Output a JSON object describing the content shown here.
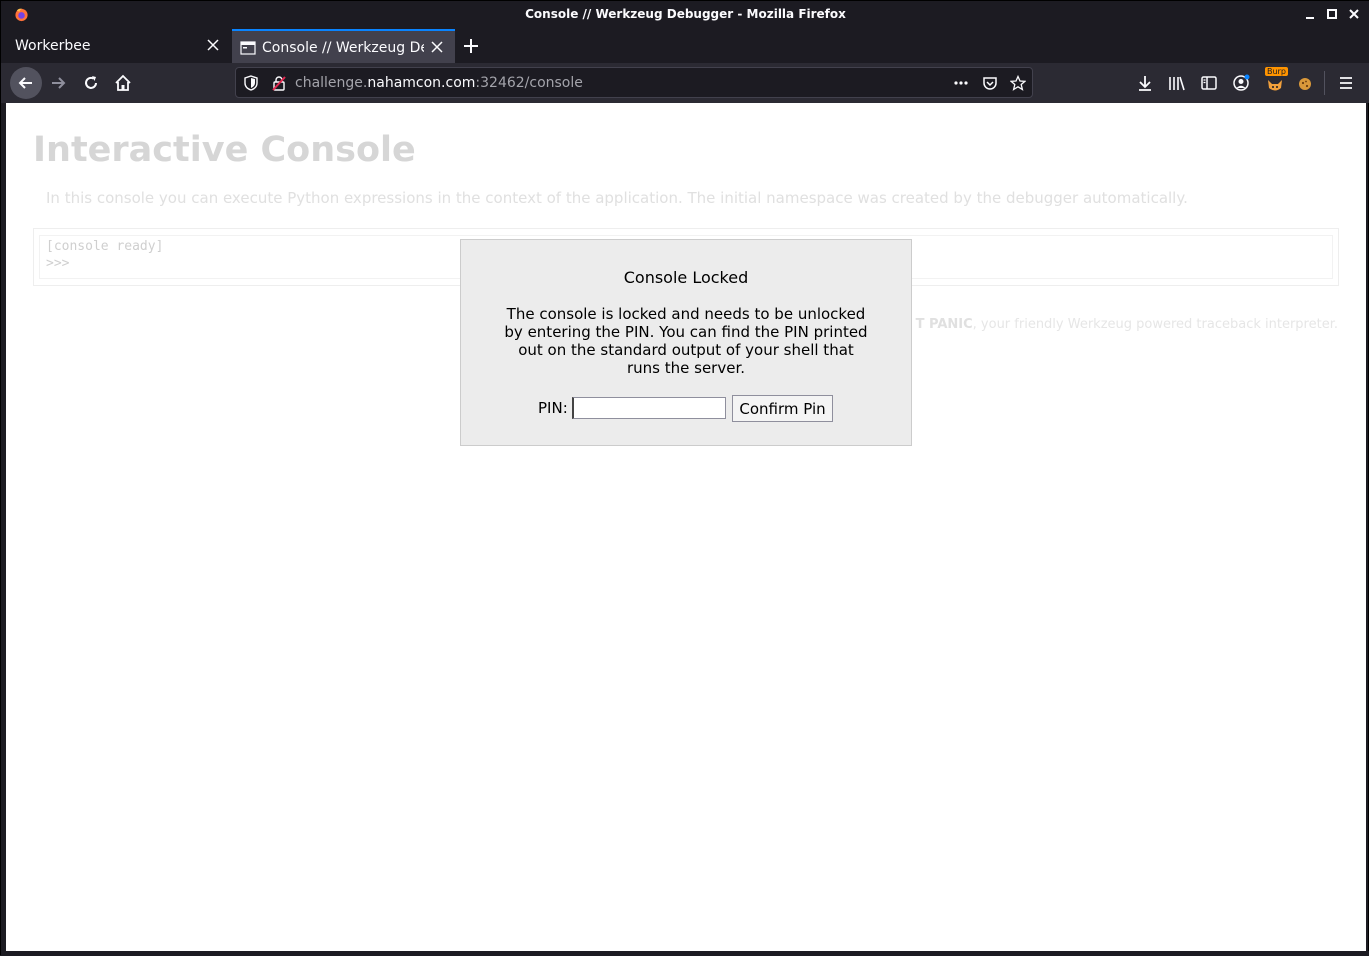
{
  "window": {
    "title": "Console // Werkzeug Debugger - Mozilla Firefox"
  },
  "tabs": [
    {
      "label": "Workerbee",
      "active": false
    },
    {
      "label": "Console // Werkzeug Deb",
      "active": true
    }
  ],
  "urlbar": {
    "prefix": "challenge.",
    "host": "nahamcon.com",
    "suffix": ":32462/console"
  },
  "toolbar": {
    "burp_badge": "Burp"
  },
  "page": {
    "title": "Interactive Console",
    "description": "In this console you can execute Python expressions in the context of the application. The initial namespace was created by the debugger automatically.",
    "console_ready": "[console ready]",
    "console_prompt": ">>>",
    "footer_bold": "T PANIC",
    "footer_rest": ", your friendly Werkzeug powered traceback interpreter."
  },
  "modal": {
    "title": "Console Locked",
    "message": "The console is locked and needs to be unlocked by entering the PIN. You can find the PIN printed out on the standard output of your shell that runs the server.",
    "pin_label": "PIN:",
    "pin_value": "",
    "confirm_label": "Confirm Pin"
  },
  "colors": {
    "accent": "#0a84ff",
    "chrome_dark": "#1c1b22",
    "navbar": "#2b2a33",
    "modal_bg": "#ececec"
  }
}
